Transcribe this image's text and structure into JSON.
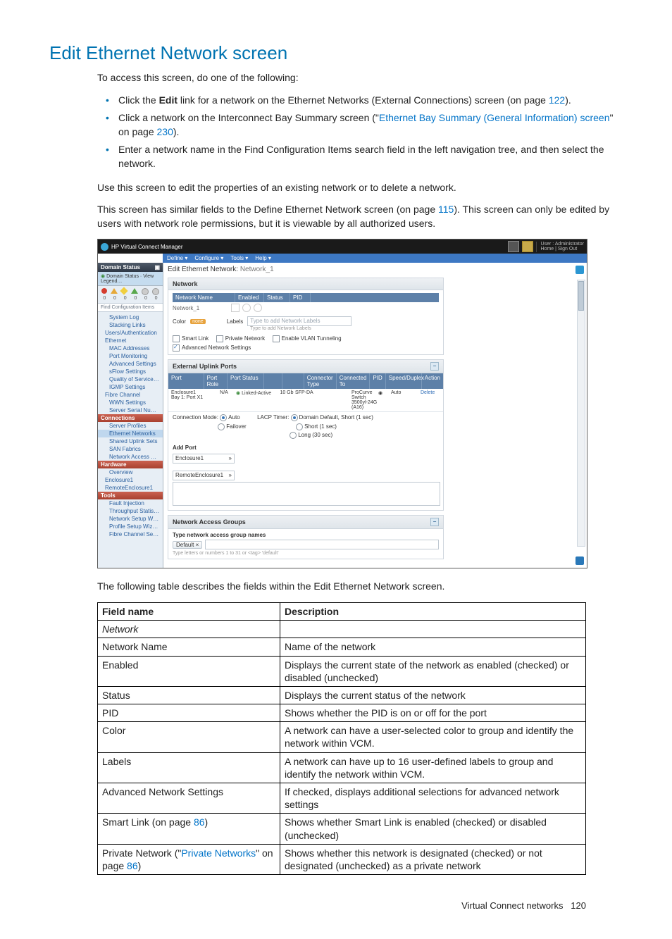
{
  "page": {
    "title": "Edit Ethernet Network screen",
    "intro": "To access this screen, do one of the following:",
    "bullets": [
      {
        "pre": "Click the ",
        "bold": "Edit",
        "post": " link for a network on the Ethernet Networks (External Connections) screen (on page ",
        "link": "122",
        "tail": ")."
      },
      {
        "pre": "Click a network on the Interconnect Bay Summary screen (\"",
        "link_text": "Ethernet Bay Summary (General Information) screen",
        "post_quote": "\" on page ",
        "link_page": "230",
        "tail": ")."
      },
      {
        "text": "Enter a network name in the Find Configuration Items search field in the left navigation tree, and then select the network."
      }
    ],
    "para1": "Use this screen to edit the properties of an existing network or to delete a network.",
    "para2_a": "This screen has similar fields to the Define Ethernet Network screen (on page ",
    "para2_link": "115",
    "para2_b": "). This screen can only be edited by users with network role permissions, but it is viewable by all authorized users.",
    "table_intro": "The following table describes the fields within the Edit Ethernet Network screen.",
    "footer_section": "Virtual Connect networks",
    "footer_page": "120"
  },
  "shot": {
    "app_title": "HP Virtual Connect Manager",
    "user_line1": "User : Administrator",
    "user_line2": "Home | Sign Out",
    "menus": [
      "Define ▾",
      "Configure ▾",
      "Tools ▾",
      "Help ▾"
    ],
    "domain_label": "Domain Status",
    "legend_label": "Domain Status · View Legend…",
    "status_counts": [
      "0",
      "0",
      "0",
      "0",
      "0",
      "0"
    ],
    "find_placeholder": "Find Configuration Items",
    "tree": [
      {
        "label": "System Log",
        "cls": "sub"
      },
      {
        "label": "Stacking Links",
        "cls": "sub"
      },
      {
        "label": "Users/Authentication",
        "cls": ""
      },
      {
        "label": "Ethernet",
        "cls": ""
      },
      {
        "label": "MAC Addresses",
        "cls": "sub"
      },
      {
        "label": "Port Monitoring",
        "cls": "sub"
      },
      {
        "label": "Advanced Settings",
        "cls": "sub"
      },
      {
        "label": "sFlow Settings",
        "cls": "sub"
      },
      {
        "label": "Quality of Service (QoS)",
        "cls": "sub"
      },
      {
        "label": "IGMP Settings",
        "cls": "sub"
      },
      {
        "label": "Fibre Channel",
        "cls": ""
      },
      {
        "label": "WWN Settings",
        "cls": "sub"
      },
      {
        "label": "Server Serial Numbers",
        "cls": "sub"
      },
      {
        "label": "Connections",
        "cls": "hdr"
      },
      {
        "label": "Server Profiles",
        "cls": "sub"
      },
      {
        "label": "Ethernet Networks",
        "cls": "sub sel"
      },
      {
        "label": "Shared Uplink Sets",
        "cls": "sub"
      },
      {
        "label": "SAN Fabrics",
        "cls": "sub"
      },
      {
        "label": "Network Access Groups",
        "cls": "sub"
      },
      {
        "label": "Hardware",
        "cls": "hdr"
      },
      {
        "label": "Overview",
        "cls": "sub"
      },
      {
        "label": "Enclosure1",
        "cls": ""
      },
      {
        "label": "RemoteEnclosure1",
        "cls": ""
      },
      {
        "label": "Tools",
        "cls": "hdr"
      },
      {
        "label": "Fault Injection",
        "cls": "sub"
      },
      {
        "label": "Throughput Statistics",
        "cls": "sub"
      },
      {
        "label": "Network Setup Wizard",
        "cls": "sub"
      },
      {
        "label": "Profile Setup Wizard",
        "cls": "sub"
      },
      {
        "label": "Fibre Channel Setup Wizard",
        "cls": "sub"
      }
    ],
    "crumb_a": "Edit Ethernet Network:",
    "crumb_b": "Network_1",
    "panel_network": "Network",
    "net_cols": [
      "Network Name",
      "Enabled",
      "Status",
      "PID"
    ],
    "net_name_val": "Network_1",
    "color_label": "Color",
    "color_value": "none",
    "labels_label": "Labels",
    "labels_placeholder": "Type to add Network Labels",
    "labels_hint": "Type to add Network Labels",
    "opt_smart": "Smart Link",
    "opt_private": "Private Network",
    "opt_vlan": "Enable VLAN Tunneling",
    "opt_adv": "Advanced Network Settings",
    "panel_uplinks": "External Uplink Ports",
    "up_cols": [
      "Port",
      "Port Role",
      "Port Status",
      "",
      "",
      "Connector Type",
      "Connected To",
      "PID",
      "Speed/Duplex",
      "Action"
    ],
    "up_row": {
      "port_a": "Enclosure1",
      "port_b": "Bay 1: Port X1",
      "role": "N/A",
      "status": "Linked-Active",
      "speed": "10 Gb",
      "conn": "SFP-DA",
      "to": "ProCurve Switch 3500yl-24G (A16)",
      "dup": "Auto",
      "action": "Delete"
    },
    "conn_mode_label": "Connection Mode:",
    "conn_mode_a": "Auto",
    "conn_mode_b": "Failover",
    "lacp_label": "LACP Timer:",
    "lacp_a": "Domain Default, Short (1 sec)",
    "lacp_b": "Short (1 sec)",
    "lacp_c": "Long (30 sec)",
    "add_port": "Add Port",
    "add_opts": [
      "Enclosure1",
      "RemoteEnclosure1"
    ],
    "panel_nag": "Network Access Groups",
    "nag_hint": "Type network access group names",
    "nag_default": "Default ×",
    "nag_hint2": "Type letters or numbers 1 to 31 or <tag> 'default'"
  },
  "table": {
    "head": [
      "Field name",
      "Description"
    ],
    "section": "Network",
    "rows": [
      {
        "f": "Network Name",
        "d": "Name of the network"
      },
      {
        "f": "Enabled",
        "d": "Displays the current state of the network as enabled (checked) or disabled (unchecked)"
      },
      {
        "f": "Status",
        "d": "Displays the current status of the network"
      },
      {
        "f": "PID",
        "d": "Shows whether the PID is on or off for the port"
      },
      {
        "f": "Color",
        "d": "A network can have a user-selected color to group and identify the network within VCM."
      },
      {
        "f": "Labels",
        "d": "A network can have up to 16 user-defined labels to group and identify the network within VCM."
      },
      {
        "f": "Advanced Network Settings",
        "d": "If checked, displays additional selections for advanced network settings"
      },
      {
        "f_pre": "Smart Link (on page ",
        "f_link": "86",
        "f_post": ")",
        "d": "Shows whether Smart Link is enabled (checked) or disabled (unchecked)"
      },
      {
        "f_pre": "Private Network (\"",
        "f_link_quoted": "Private Networks",
        "f_mid": "\" on page ",
        "f_link": "86",
        "f_post": ")",
        "d": "Shows whether this network is designated (checked) or not designated (unchecked) as a private network"
      }
    ]
  }
}
